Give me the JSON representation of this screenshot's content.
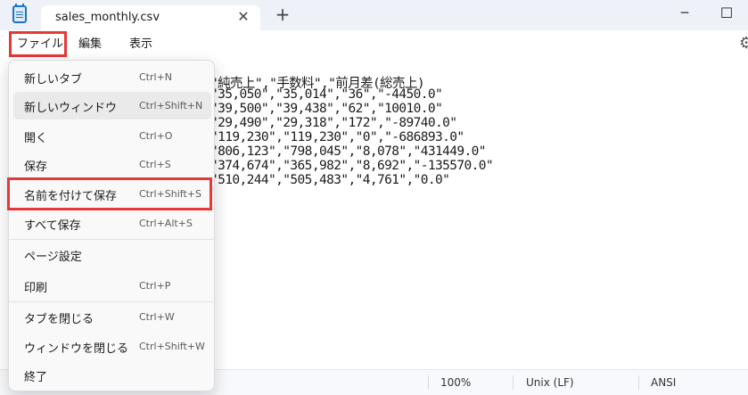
{
  "window": {
    "tab_title": "sales_monthly.csv",
    "tab_close": "✕",
    "new_tab": "+",
    "minimize": "─",
    "maximize": "☐"
  },
  "menubar": {
    "file": "ファイル",
    "edit": "編集",
    "view": "表示",
    "settings_glyph": "⚙"
  },
  "editor": {
    "lines": [
      "\"純売上\",\"手数料\",\"前月差(総売上)",
      "\"35,050\",\"35,014\",\"36\",\"-4450.0\"",
      "\"39,500\",\"39,438\",\"62\",\"10010.0\"",
      "\"29,490\",\"29,318\",\"172\",\"-89740.0\"",
      "\"119,230\",\"119,230\",\"0\",\"-686893.0\"",
      "\"806,123\",\"798,045\",\"8,078\",\"431449.0\"",
      "\"374,674\",\"365,982\",\"8,692\",\"-135570.0\"",
      "\"510,244\",\"505,483\",\"4,761\",\"0.0\""
    ]
  },
  "file_menu": {
    "items": [
      {
        "label": "新しいタブ",
        "shortcut": "Ctrl+N"
      },
      {
        "label": "新しいウィンドウ",
        "shortcut": "Ctrl+Shift+N"
      },
      {
        "label": "開く",
        "shortcut": "Ctrl+O"
      },
      {
        "label": "保存",
        "shortcut": "Ctrl+S"
      },
      {
        "label": "名前を付けて保存",
        "shortcut": "Ctrl+Shift+S"
      },
      {
        "label": "すべて保存",
        "shortcut": "Ctrl+Alt+S"
      },
      {
        "label": "ページ設定",
        "shortcut": ""
      },
      {
        "label": "印刷",
        "shortcut": "Ctrl+P"
      },
      {
        "label": "タブを閉じる",
        "shortcut": "Ctrl+W"
      },
      {
        "label": "ウィンドウを閉じる",
        "shortcut": "Ctrl+Shift+W"
      },
      {
        "label": "終了",
        "shortcut": ""
      }
    ]
  },
  "status": {
    "zoom": "100%",
    "line_ending": "Unix (LF)",
    "encoding": "ANSI"
  },
  "colors": {
    "highlight_box": "#e53935",
    "app_icon": "#1e73c8"
  }
}
